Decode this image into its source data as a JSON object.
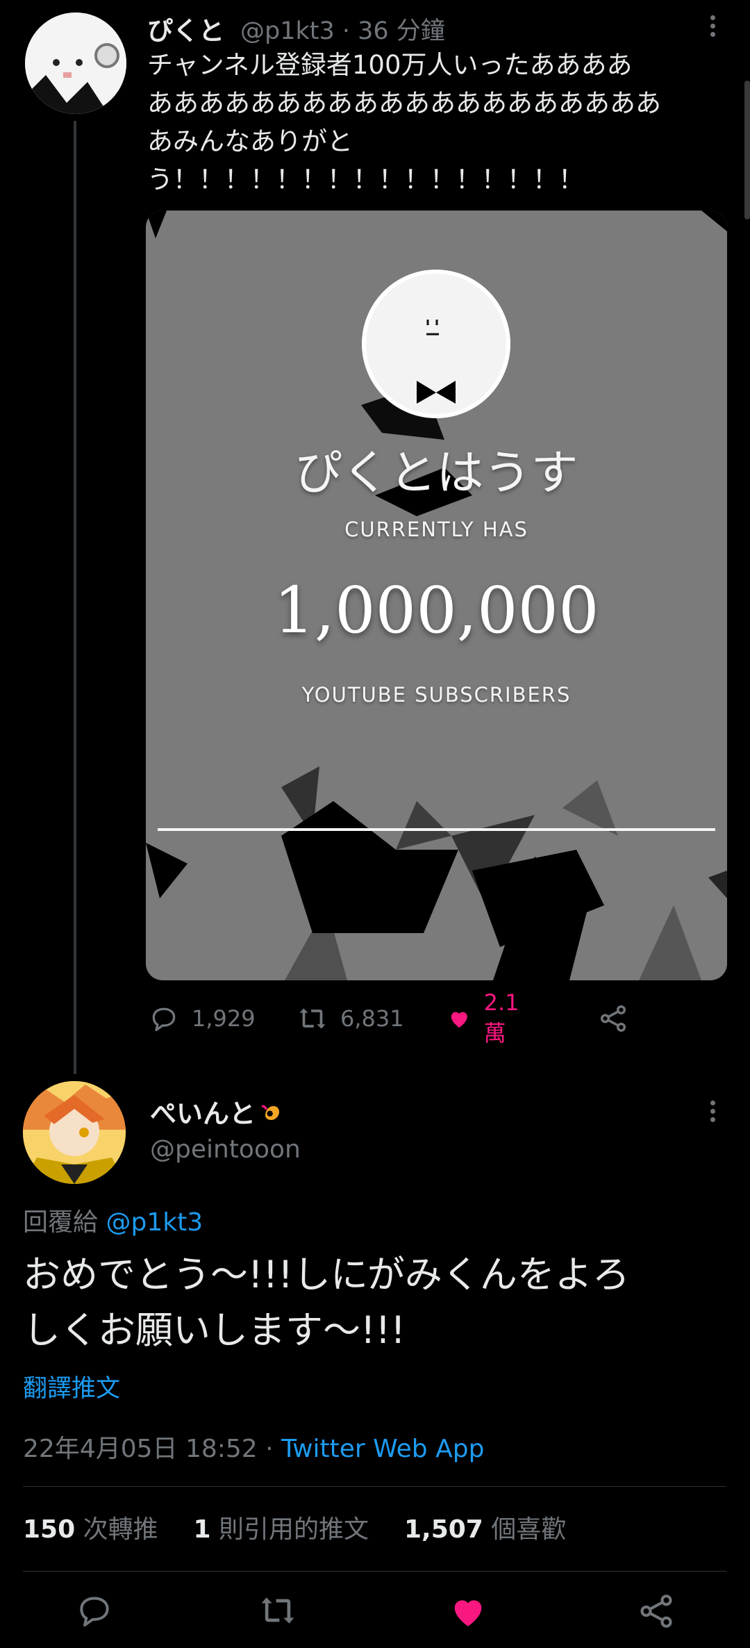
{
  "colors": {
    "background": "#000000",
    "text": "#e7e9ea",
    "muted": "#71767b",
    "link": "#1d9bf0",
    "like": "#f91880"
  },
  "tweet": {
    "name": "ぴくと",
    "handle_time": "@p1kt3 · 36 分鐘",
    "text_lines": [
      "チャンネル登録者100万人いったああああ",
      "ああああああああああああああああああああ",
      "あみんなありがと",
      "う！！！！！！！！！！！！！！！！"
    ],
    "card": {
      "channel_name": "ぴくとはうす",
      "currently_has": "CURRENTLY HAS",
      "count": "1,000,000",
      "subscribers": "YOUTUBE SUBSCRIBERS"
    },
    "actions": {
      "replies": "1,929",
      "retweets": "6,831",
      "likes": "2.1萬"
    },
    "icons": [
      "reply-icon",
      "retweet-icon",
      "heart-icon",
      "share-icon",
      "more-icon"
    ]
  },
  "reply": {
    "name": "ぺいんと",
    "handle": "@peintooon",
    "reply_prefix": "回覆給",
    "reply_to": "@p1kt3",
    "text_lines": [
      "おめでとう〜!!!しにがみくんをよろ",
      "しくお願いします〜!!!"
    ],
    "translate": "翻譯推文",
    "date": "22年4月05日 18:52",
    "separator": " · ",
    "source": "Twitter Web App",
    "stats": {
      "retweets_count": "150",
      "retweets_label": "次轉推",
      "quotes_count": "1",
      "quotes_label": "則引用的推文",
      "likes_count": "1,507",
      "likes_label": "個喜歡"
    }
  }
}
